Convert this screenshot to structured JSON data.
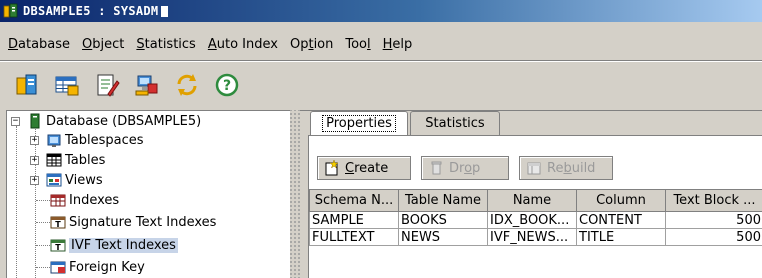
{
  "window": {
    "title": "DBSAMPLE5 : SYSADM"
  },
  "menubar": [
    {
      "label": "Database",
      "mnemonic": "D",
      "rest": "atabase"
    },
    {
      "label": "Object",
      "mnemonic": "O",
      "rest": "bject"
    },
    {
      "label": "Statistics",
      "mnemonic": "S",
      "rest": "tatistics"
    },
    {
      "label": "Auto Index",
      "mnemonic": "A",
      "rest": "uto Index"
    },
    {
      "label": "Option",
      "pre": "Op",
      "mnemonic": "t",
      "rest": "ion"
    },
    {
      "label": "Tool",
      "pre": "Too",
      "mnemonic": "l",
      "rest": ""
    },
    {
      "label": "Help",
      "mnemonic": "H",
      "rest": "elp"
    }
  ],
  "toolbar": [
    "database-tool-icon",
    "table-tool-icon",
    "edit-document-icon",
    "network-computer-icon",
    "refresh-icon",
    "help-icon"
  ],
  "tree": {
    "root": "Database (DBSAMPLE5)",
    "items": [
      {
        "label": "Tablespaces",
        "expandable": true,
        "icon": "tablespace-icon"
      },
      {
        "label": "Tables",
        "expandable": true,
        "icon": "table-icon"
      },
      {
        "label": "Views",
        "expandable": true,
        "icon": "view-icon"
      },
      {
        "label": "Indexes",
        "expandable": false,
        "icon": "index-icon"
      },
      {
        "label": "Signature Text Indexes",
        "expandable": false,
        "icon": "signature-text-index-icon"
      },
      {
        "label": "IVF Text Indexes",
        "expandable": false,
        "icon": "ivf-text-index-icon",
        "selected": true
      },
      {
        "label": "Foreign Key",
        "expandable": false,
        "icon": "foreign-key-icon"
      }
    ]
  },
  "tabs": [
    {
      "label": "Properties",
      "active": true
    },
    {
      "label": "Statistics",
      "active": false
    }
  ],
  "actions": {
    "create": {
      "mnemonic": "C",
      "rest": "reate"
    },
    "drop": {
      "pre": "Dr",
      "mnemonic": "o",
      "rest": "p"
    },
    "rebuild": {
      "pre": "Re",
      "mnemonic": "b",
      "rest": "uild"
    }
  },
  "grid": {
    "columns": [
      "Schema N...",
      "Table Name",
      "Name",
      "Column",
      "Text Block ..."
    ],
    "rows": [
      [
        "SAMPLE",
        "BOOKS",
        "IDX_BOOK...",
        "CONTENT",
        "500"
      ],
      [
        "FULLTEXT",
        "NEWS",
        "IVF_NEWS...",
        "TITLE",
        "500"
      ]
    ]
  }
}
